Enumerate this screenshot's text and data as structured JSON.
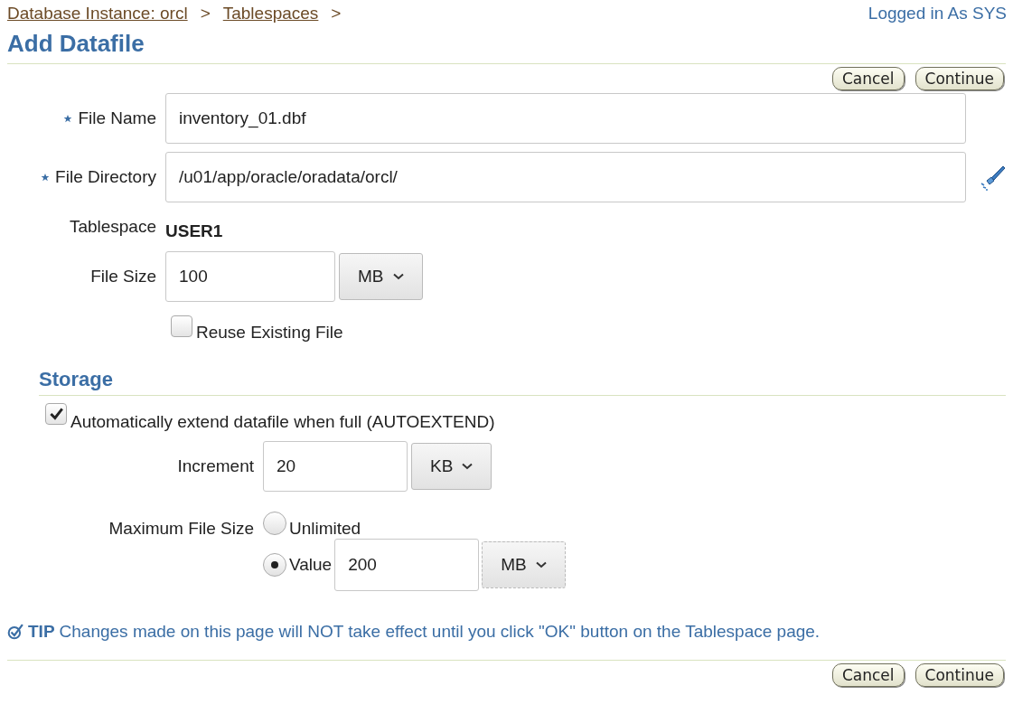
{
  "breadcrumb": [
    {
      "kind": "link",
      "text": "Database Instance: orcl"
    },
    {
      "kind": "separator",
      "text": ">"
    },
    {
      "kind": "link",
      "text": "Tablespaces"
    },
    {
      "kind": "separator",
      "text": ">"
    }
  ],
  "login": "Logged in As SYS",
  "title": "Add Datafile",
  "top_buttons": [
    "Cancel",
    "Continue"
  ],
  "fields": [
    {
      "kind": "text",
      "label": "File Name",
      "required": true,
      "value": "inventory_01.dbf"
    },
    {
      "kind": "browse",
      "label": "File Directory",
      "required": true,
      "value": "/u01/app/oracle/oradata/orcl/"
    },
    {
      "kind": "static",
      "label": "Tablespace",
      "value": "USER1"
    },
    {
      "kind": "size",
      "label": "File Size",
      "value": "100",
      "unit": "MB"
    },
    {
      "kind": "checkbox",
      "label": "Reuse Existing File",
      "checked": false
    }
  ],
  "storage": {
    "title": "Storage",
    "autoextend": {
      "label": "Automatically extend datafile when full (AUTOEXTEND)",
      "checked": true
    },
    "increment": {
      "label": "Increment",
      "value": "20",
      "unit": "KB"
    },
    "max_size": {
      "label": "Maximum File Size",
      "options": [
        {
          "label": "Unlimited",
          "selected": false
        },
        {
          "label": "Value",
          "selected": true,
          "value": "200",
          "unit": "MB"
        }
      ]
    }
  },
  "tip": {
    "label": "TIP",
    "text": "Changes made on this page will NOT take effect until you click \"OK\" button on the Tablespace page."
  },
  "bottom_buttons": [
    "Cancel",
    "Continue"
  ]
}
